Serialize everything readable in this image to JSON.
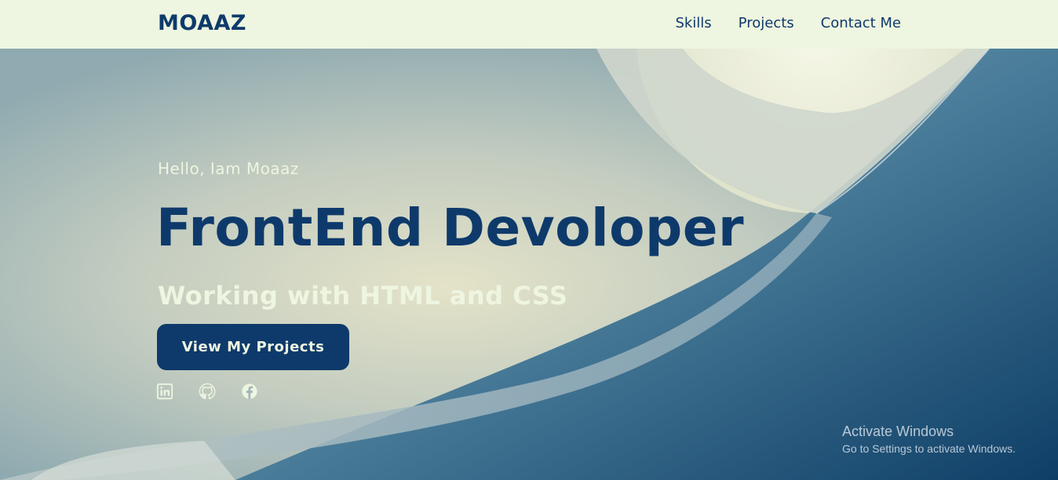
{
  "navbar": {
    "logo": "MOAAZ",
    "links": [
      "Skills",
      "Projects",
      "Contact Me"
    ]
  },
  "hero": {
    "greeting": "Hello, Iam Moaaz",
    "title": "FrontEnd Devoloper",
    "subtitle": "Working with HTML and CSS",
    "cta_label": "View My Projects",
    "socials": [
      "linkedin-icon",
      "github-icon",
      "facebook-icon"
    ]
  },
  "watermark": {
    "title": "Activate Windows",
    "subtitle": "Go to Settings to activate Windows."
  },
  "colors": {
    "primary": "#0e3a6b",
    "light": "#eef5e0"
  }
}
